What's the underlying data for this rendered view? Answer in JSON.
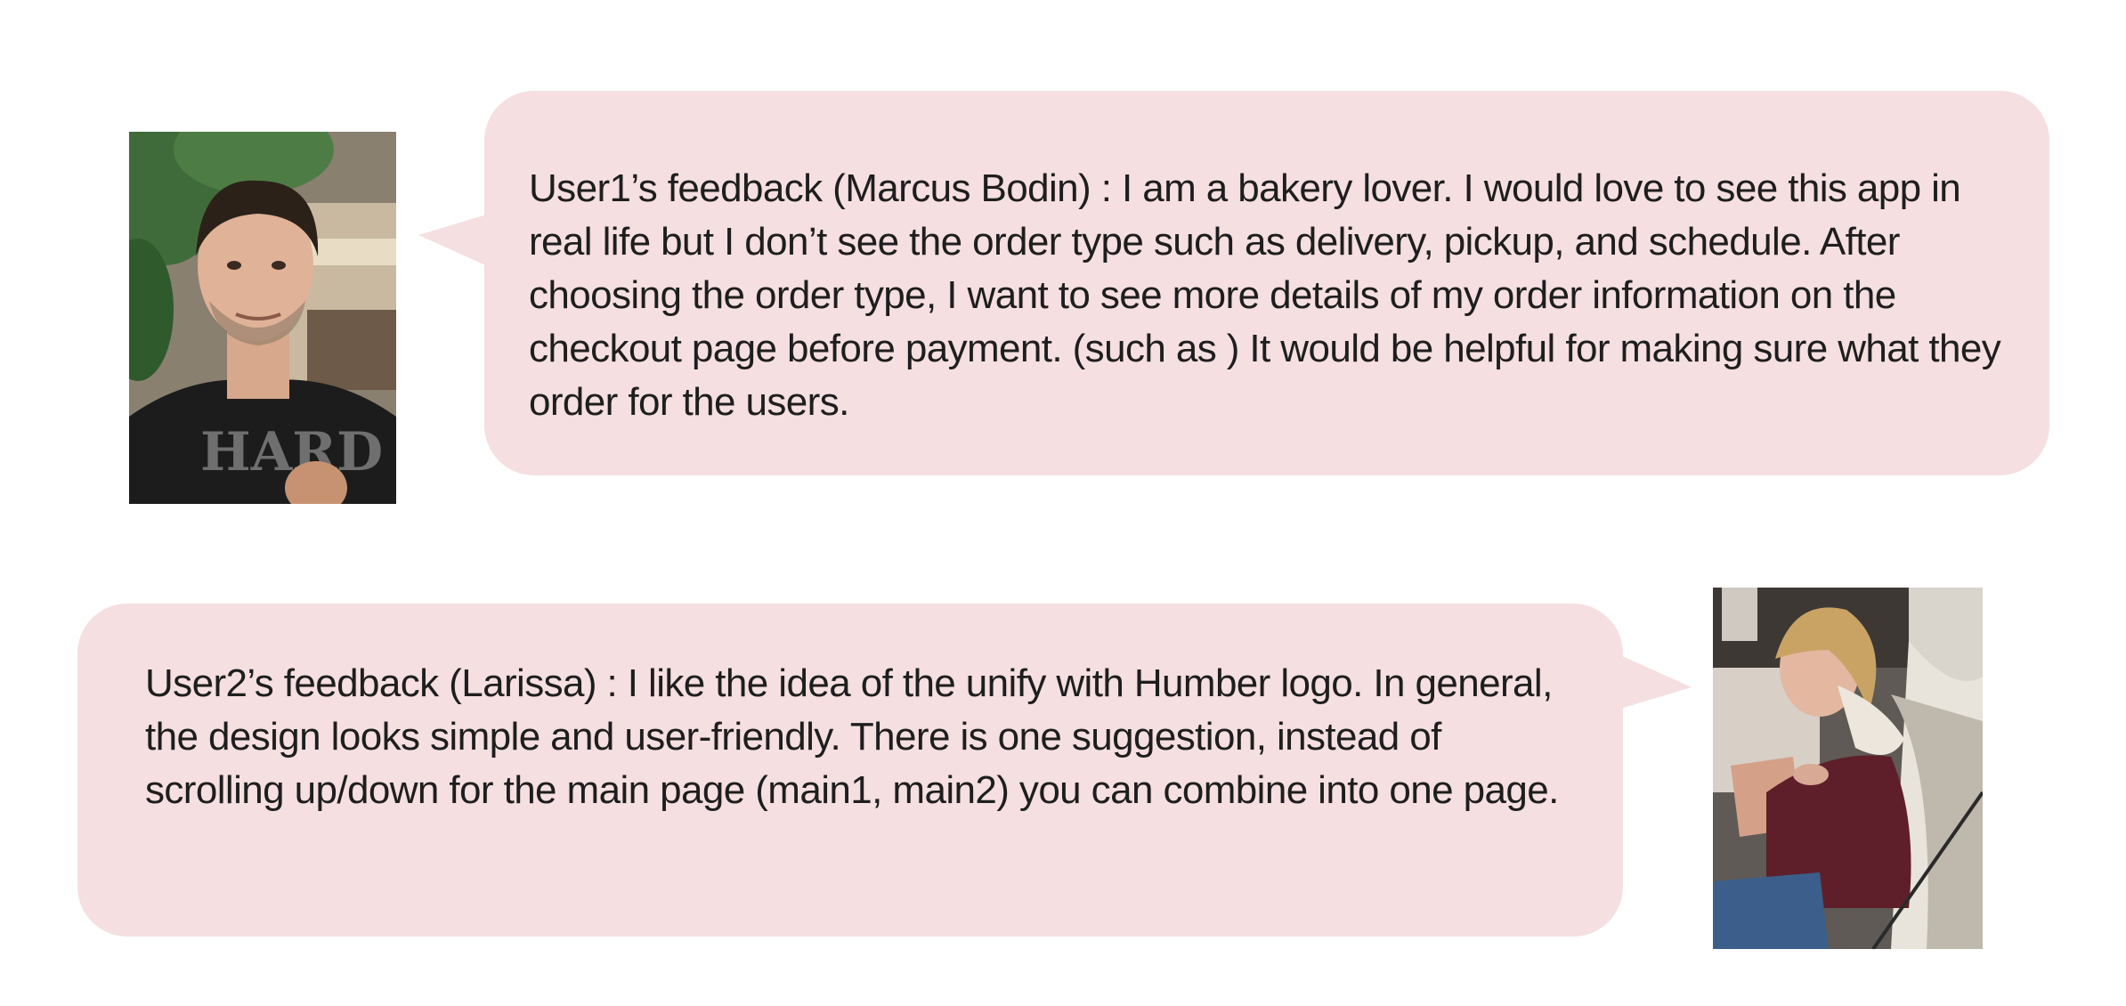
{
  "feedback": [
    {
      "text": "User1’s feedback (Marcus Bodin) : I am a bakery lover. I would love to see this app in real life but I don’t see the order type such as delivery, pickup, and schedule. After choosing the order type, I want to see more details of my order information on the checkout page before payment. (such as ) It would be helpful for making sure what they order for the users."
    },
    {
      "text": "User2’s feedback (Larissa) : I like the idea of the unify with Humber logo. In general, the design looks simple and user-friendly. There is one suggestion, instead of scrolling up/down for the main page (main1, main2) you can combine into one page."
    }
  ],
  "colors": {
    "bubble": "#f5dfe0",
    "text": "#1e1e1e"
  }
}
